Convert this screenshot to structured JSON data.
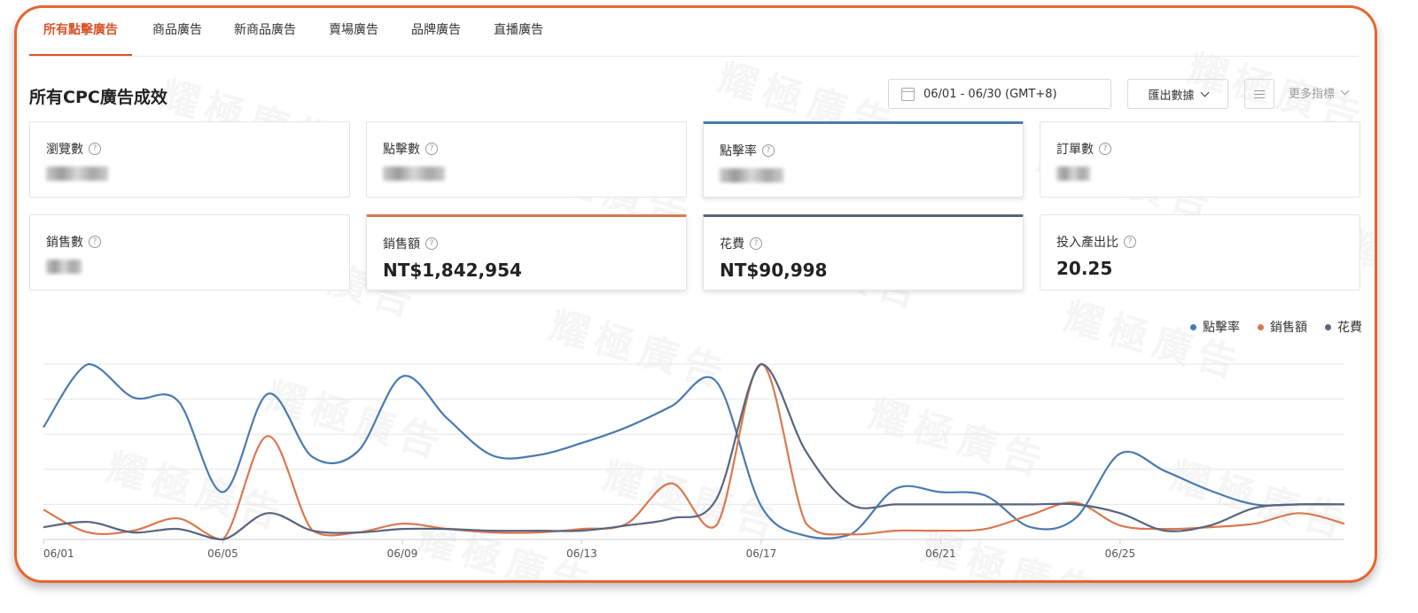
{
  "tabs": [
    {
      "label": "所有點擊廣告",
      "active": true
    },
    {
      "label": "商品廣告",
      "active": false
    },
    {
      "label": "新商品廣告",
      "active": false
    },
    {
      "label": "賣場廣告",
      "active": false
    },
    {
      "label": "品牌廣告",
      "active": false
    },
    {
      "label": "直播廣告",
      "active": false
    }
  ],
  "page_title": "所有CPC廣告成效",
  "toolbar": {
    "date_range": "06/01 - 06/30 (GMT+8)",
    "export_label": "匯出數據",
    "more_metrics_label": "更多指標"
  },
  "metrics": [
    {
      "label": "瀏覽數",
      "value": "",
      "blurred": true
    },
    {
      "label": "點擊數",
      "value": "",
      "blurred": true
    },
    {
      "label": "點擊率",
      "value": "",
      "blurred": true,
      "highlight": "#4a7ab0"
    },
    {
      "label": "訂單數",
      "value": "",
      "blurred": true
    },
    {
      "label": "銷售數",
      "value": "",
      "blurred": true
    },
    {
      "label": "銷售額",
      "value": "NT$1,842,954",
      "blurred": false,
      "highlight": "#d9784f"
    },
    {
      "label": "花費",
      "value": "NT$90,998",
      "blurred": false,
      "highlight": "#58657e"
    },
    {
      "label": "投入產出比",
      "value": "20.25",
      "blurred": false
    }
  ],
  "watermark_text": "耀極廣告",
  "chart_data": {
    "type": "line",
    "x": [
      "06/01",
      "06/02",
      "06/03",
      "06/04",
      "06/05",
      "06/06",
      "06/07",
      "06/08",
      "06/09",
      "06/10",
      "06/11",
      "06/12",
      "06/13",
      "06/14",
      "06/15",
      "06/16",
      "06/17",
      "06/18",
      "06/19",
      "06/20",
      "06/21",
      "06/22",
      "06/23",
      "06/24",
      "06/25",
      "06/26",
      "06/27",
      "06/28",
      "06/29",
      "06/30"
    ],
    "tick_labels": [
      "06/01",
      "06/05",
      "06/09",
      "06/13",
      "06/17",
      "06/21",
      "06/25"
    ],
    "series": [
      {
        "name": "點擊率",
        "color": "#4a7ab0",
        "values": [
          0.64,
          1.0,
          0.81,
          0.79,
          0.27,
          0.83,
          0.47,
          0.5,
          0.93,
          0.69,
          0.48,
          0.48,
          0.55,
          0.64,
          0.76,
          0.9,
          0.19,
          0.02,
          0.03,
          0.29,
          0.27,
          0.25,
          0.07,
          0.12,
          0.49,
          0.39,
          0.28,
          0.2,
          0.2,
          0.2
        ]
      },
      {
        "name": "銷售額",
        "color": "#d9784f",
        "values": [
          0.17,
          0.04,
          0.05,
          0.12,
          0.0,
          0.59,
          0.05,
          0.04,
          0.09,
          0.06,
          0.04,
          0.04,
          0.06,
          0.09,
          0.32,
          0.08,
          1.0,
          0.09,
          0.03,
          0.05,
          0.05,
          0.06,
          0.14,
          0.21,
          0.08,
          0.06,
          0.07,
          0.09,
          0.15,
          0.09
        ]
      },
      {
        "name": "花費",
        "color": "#58657e",
        "values": [
          0.07,
          0.1,
          0.04,
          0.06,
          0.0,
          0.15,
          0.05,
          0.04,
          0.06,
          0.06,
          0.05,
          0.05,
          0.05,
          0.08,
          0.12,
          0.23,
          1.0,
          0.5,
          0.2,
          0.2,
          0.2,
          0.2,
          0.2,
          0.2,
          0.15,
          0.05,
          0.08,
          0.18,
          0.2,
          0.2
        ]
      }
    ],
    "ylim": [
      0,
      1
    ],
    "grid": true,
    "legend_position": "top-right"
  }
}
